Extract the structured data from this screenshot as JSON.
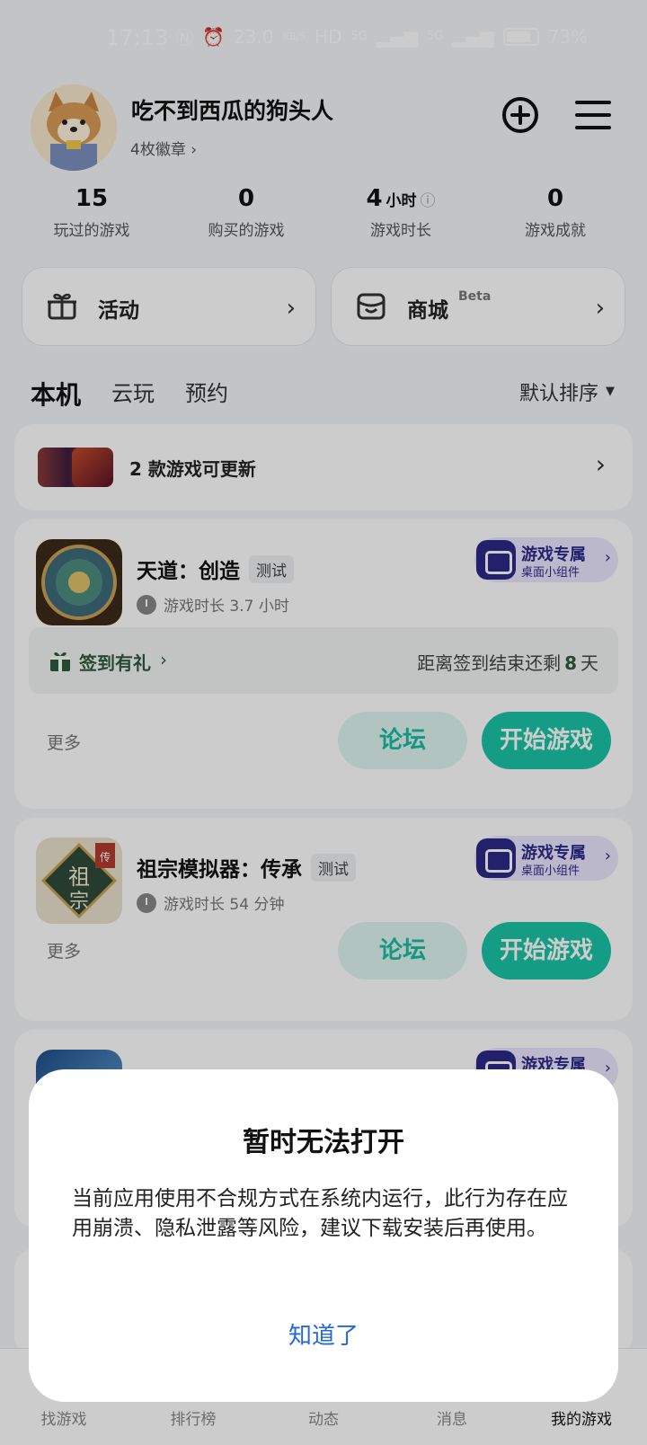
{
  "status_bar": {
    "time": "17:13",
    "net_speed": "23.0",
    "net_unit": "KB/S",
    "hd": "HD",
    "sig1": "5G",
    "sig2": "5G",
    "battery": "73%"
  },
  "profile": {
    "username": "吃不到西瓜的狗头人",
    "badges": "4枚徽章 ›"
  },
  "stats": [
    {
      "value": "15",
      "unit": "",
      "label": "玩过的游戏"
    },
    {
      "value": "0",
      "unit": "",
      "label": "购买的游戏"
    },
    {
      "value": "4",
      "unit": "小时",
      "label": "游戏时长"
    },
    {
      "value": "0",
      "unit": "",
      "label": "游戏成就"
    }
  ],
  "entries": {
    "activity": "活动",
    "shop": "商城",
    "shop_beta": "Beta"
  },
  "tabs": [
    "本机",
    "云玩",
    "预约"
  ],
  "sort_label": "默认排序",
  "update_text": "2 款游戏可更新",
  "widget": {
    "line1": "游戏专属",
    "line2": "桌面小组件"
  },
  "games": [
    {
      "title": "天道：创造",
      "tag": "测试",
      "playtime": "游戏时长 3.7 小时",
      "checkin_label": "签到有礼",
      "checkin_right_prefix": "距离签到结束还剩",
      "checkin_days": "8",
      "checkin_right_suffix": "天"
    },
    {
      "title": "祖宗模拟器：传承",
      "tag": "测试",
      "playtime": "游戏时长 54 分钟"
    }
  ],
  "actions": {
    "more": "更多",
    "forum": "论坛",
    "play": "开始游戏"
  },
  "bottom_nav": [
    "找游戏",
    "排行榜",
    "动态",
    "消息",
    "我的游戏"
  ],
  "dialog": {
    "title": "暂时无法打开",
    "body": "当前应用使用不合规方式在系统内运行，此行为存在应用崩溃、隐私泄露等风险，建议下载安装后再使用。",
    "ok": "知道了"
  },
  "colors": {
    "accent": "#19c3a6",
    "link": "#2468d8",
    "widget": "#2d2a88"
  }
}
